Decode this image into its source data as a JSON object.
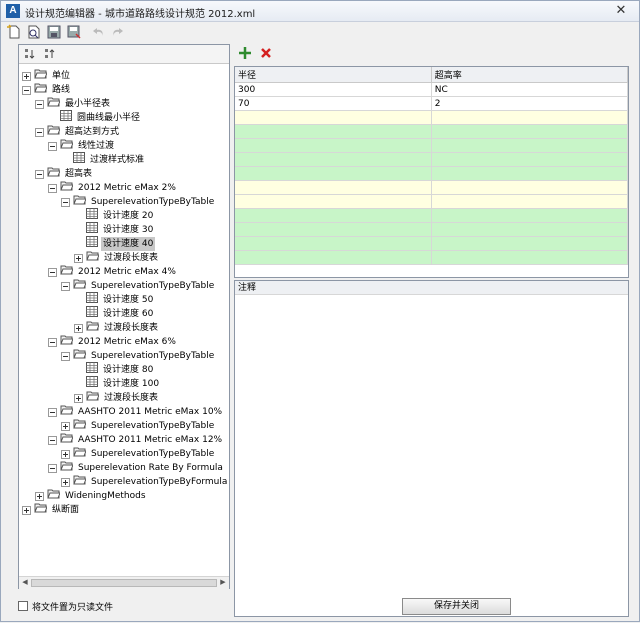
{
  "window": {
    "title": "设计规范编辑器 - 城市道路路线设计规范 2012.xml",
    "close_glyph": "✕"
  },
  "tree": [
    {
      "label": "单位",
      "level": 0,
      "exp": "plus",
      "icon": "folder-icon"
    },
    {
      "label": "路线",
      "level": 0,
      "exp": "minus",
      "icon": "folder-icon"
    },
    {
      "label": "最小半径表",
      "level": 1,
      "exp": "minus",
      "icon": "folder-icon"
    },
    {
      "label": "圆曲线最小半径",
      "level": 2,
      "exp": "none",
      "icon": "table-icon"
    },
    {
      "label": "超高达到方式",
      "level": 1,
      "exp": "minus",
      "icon": "folder-icon"
    },
    {
      "label": "线性过渡",
      "level": 2,
      "exp": "minus",
      "icon": "folder-icon"
    },
    {
      "label": "过渡样式标准",
      "level": 3,
      "exp": "none",
      "icon": "table-icon"
    },
    {
      "label": "超高表",
      "level": 1,
      "exp": "minus",
      "icon": "folder-icon"
    },
    {
      "label": "2012 Metric eMax 2%",
      "level": 2,
      "exp": "minus",
      "icon": "folder-icon"
    },
    {
      "label": "SuperelevationTypeByTable",
      "level": 3,
      "exp": "minus",
      "icon": "folder-icon"
    },
    {
      "label": "设计速度 20",
      "level": 4,
      "exp": "none",
      "icon": "table-icon"
    },
    {
      "label": "设计速度 30",
      "level": 4,
      "exp": "none",
      "icon": "table-icon"
    },
    {
      "label": "设计速度 40",
      "level": 4,
      "exp": "none",
      "icon": "table-icon",
      "selected": true
    },
    {
      "label": "过渡段长度表",
      "level": 4,
      "exp": "plus",
      "icon": "folder-icon"
    },
    {
      "label": "2012 Metric eMax 4%",
      "level": 2,
      "exp": "minus",
      "icon": "folder-icon"
    },
    {
      "label": "SuperelevationTypeByTable",
      "level": 3,
      "exp": "minus",
      "icon": "folder-icon"
    },
    {
      "label": "设计速度 50",
      "level": 4,
      "exp": "none",
      "icon": "table-icon"
    },
    {
      "label": "设计速度 60",
      "level": 4,
      "exp": "none",
      "icon": "table-icon"
    },
    {
      "label": "过渡段长度表",
      "level": 4,
      "exp": "plus",
      "icon": "folder-icon"
    },
    {
      "label": "2012 Metric eMax 6%",
      "level": 2,
      "exp": "minus",
      "icon": "folder-icon"
    },
    {
      "label": "SuperelevationTypeByTable",
      "level": 3,
      "exp": "minus",
      "icon": "folder-icon"
    },
    {
      "label": "设计速度 80",
      "level": 4,
      "exp": "none",
      "icon": "table-icon"
    },
    {
      "label": "设计速度 100",
      "level": 4,
      "exp": "none",
      "icon": "table-icon"
    },
    {
      "label": "过渡段长度表",
      "level": 4,
      "exp": "plus",
      "icon": "folder-icon"
    },
    {
      "label": "AASHTO 2011 Metric eMax 10%",
      "level": 2,
      "exp": "minus",
      "icon": "folder-icon"
    },
    {
      "label": "SuperelevationTypeByTable",
      "level": 3,
      "exp": "plus",
      "icon": "folder-icon"
    },
    {
      "label": "AASHTO 2011 Metric eMax 12%",
      "level": 2,
      "exp": "minus",
      "icon": "folder-icon"
    },
    {
      "label": "SuperelevationTypeByTable",
      "level": 3,
      "exp": "plus",
      "icon": "folder-icon"
    },
    {
      "label": "Superelevation Rate By Formula",
      "level": 2,
      "exp": "minus",
      "icon": "folder-icon"
    },
    {
      "label": "SuperelevationTypeByFormula",
      "level": 3,
      "exp": "plus",
      "icon": "folder-icon"
    },
    {
      "label": "WideningMethods",
      "level": 1,
      "exp": "plus",
      "icon": "folder-icon"
    },
    {
      "label": "纵断面",
      "level": 0,
      "exp": "plus",
      "icon": "folder-icon"
    }
  ],
  "grid": {
    "columns": [
      "半径",
      "超高率"
    ],
    "rows": [
      {
        "cells": [
          "300",
          "NC"
        ],
        "style": "w"
      },
      {
        "cells": [
          "70",
          "2"
        ],
        "style": "w"
      },
      {
        "cells": [
          "",
          ""
        ],
        "style": "y"
      },
      {
        "cells": [
          "",
          ""
        ],
        "style": "g"
      },
      {
        "cells": [
          "",
          ""
        ],
        "style": "g"
      },
      {
        "cells": [
          "",
          ""
        ],
        "style": "g"
      },
      {
        "cells": [
          "",
          ""
        ],
        "style": "g"
      },
      {
        "cells": [
          "",
          ""
        ],
        "style": "y"
      },
      {
        "cells": [
          "",
          ""
        ],
        "style": "y"
      },
      {
        "cells": [
          "",
          ""
        ],
        "style": "g"
      },
      {
        "cells": [
          "",
          ""
        ],
        "style": "g"
      },
      {
        "cells": [
          "",
          ""
        ],
        "style": "g"
      },
      {
        "cells": [
          "",
          ""
        ],
        "style": "g"
      }
    ]
  },
  "notes": {
    "header": "注释"
  },
  "footer": {
    "readonly_label": "将文件置为只读文件",
    "save_close_label": "保存并关闭"
  },
  "colors": {
    "green_row": "#c8f5c8",
    "yellow_row": "#ffffe1",
    "selected": "#c8c8c8",
    "add_icon": "#2e8b2e",
    "delete_icon": "#d42020"
  }
}
